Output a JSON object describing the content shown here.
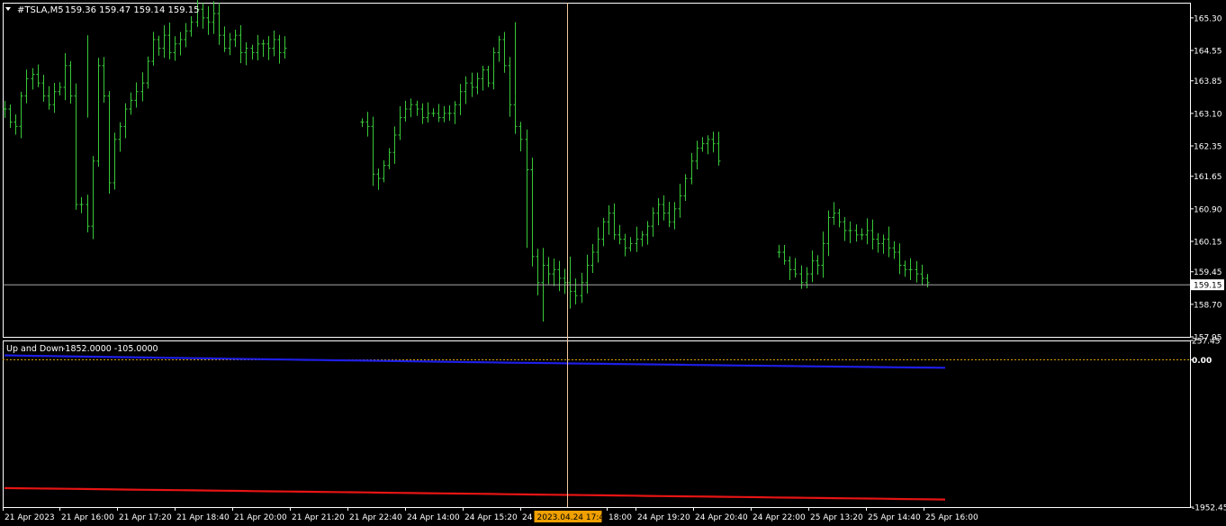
{
  "header": {
    "symbol": "#TSLA,M5",
    "ohlc": "159.36 159.47 159.14 159.15"
  },
  "colors": {
    "background": "#000000",
    "frame": "#ffffff",
    "bar": "#38c838",
    "crosshair": "#f5c8a0",
    "priceLine": "#c0c0c0",
    "zeroLine": "#d8a000",
    "series1": "#1e1ee6",
    "series2": "#e61414",
    "dateBadgeBg": "#f0a000",
    "dateBadgeText": "#000000"
  },
  "chart_data": [
    {
      "type": "ohlc",
      "symbol": "#TSLA",
      "timeframe": "M5",
      "ylim": [
        157.95,
        165.65
      ],
      "yticks": [
        "165.30",
        "164.55",
        "163.85",
        "163.10",
        "162.35",
        "161.65",
        "160.90",
        "160.15",
        "159.45",
        "158.70",
        "157.95"
      ],
      "current_price": "159.15",
      "segments": [
        {
          "start": 0,
          "close": [
            163.2,
            162.9,
            162.8,
            163.5,
            163.9,
            164.0,
            163.8,
            163.5,
            163.3,
            163.6,
            163.7,
            164.2,
            163.5,
            161.0,
            161.0,
            160.5,
            162.0,
            164.2,
            163.5,
            161.5,
            162.5,
            162.8,
            163.2,
            163.4,
            163.6,
            163.8,
            164.3,
            164.8,
            164.6,
            164.9,
            164.5,
            164.7,
            164.8,
            165.0,
            165.2,
            165.5,
            165.3,
            165.2,
            165.4,
            164.9,
            164.6,
            164.8,
            164.9,
            164.5,
            164.6,
            164.5,
            164.7,
            164.7,
            164.6,
            164.8,
            164.5,
            164.6
          ]
        },
        {
          "start": 65,
          "close": [
            162.9,
            162.8,
            161.7,
            161.6,
            161.9,
            162.2,
            162.6,
            163.0,
            163.2,
            163.3,
            163.2,
            163.0,
            163.1,
            163.1,
            163.0,
            163.1,
            163.1,
            163.3,
            163.6,
            163.8,
            163.7,
            163.9,
            164.1,
            163.8,
            164.5,
            164.8,
            164.2,
            163.3,
            162.8,
            162.5,
            161.8,
            159.8,
            159.2,
            159.6,
            159.4,
            159.5,
            159.3,
            159.2,
            159.0,
            158.9,
            159.2,
            159.6,
            159.9,
            160.2,
            160.6,
            160.8,
            160.3,
            160.2,
            160.0,
            160.1,
            160.2,
            160.3,
            160.5,
            160.8,
            161.0,
            160.8,
            160.6,
            160.9,
            161.2,
            161.6,
            162.0,
            162.3,
            162.4,
            162.5,
            162.4,
            162.0
          ]
        },
        {
          "start": 141,
          "close": [
            159.9,
            159.7,
            159.5,
            159.4,
            159.2,
            159.4,
            159.7,
            159.6,
            160.1,
            160.7,
            160.8,
            160.6,
            160.4,
            160.4,
            160.3,
            160.3,
            160.4,
            160.2,
            160.1,
            160.2,
            160.0,
            159.9,
            159.6,
            159.5,
            159.5,
            159.4,
            159.3,
            159.2
          ]
        }
      ]
    },
    {
      "type": "line",
      "title": "Up and Down",
      "values_label": "-1852.0000 -105.0000",
      "ylim": [
        -1952.45,
        257.45
      ],
      "yticks": [
        "257.45",
        "0.00",
        "-1952.45"
      ],
      "zero_line": 0,
      "series": [
        {
          "values": [
            60,
            -105
          ]
        },
        {
          "values": [
            -1700,
            -1852
          ]
        }
      ]
    }
  ],
  "x_axis": {
    "labels": [
      "21 Apr 2023",
      "21 Apr 16:00",
      "21 Apr 17:20",
      "21 Apr 18:40",
      "21 Apr 20:00",
      "21 Apr 21:20",
      "21 Apr 22:40",
      "24 Apr 14:00",
      "24 Apr 15:20",
      "24",
      "18:00",
      "24 Apr 19:20",
      "24 Apr 20:40",
      "24 Apr 22:00",
      "25 Apr 13:20",
      "25 Apr 14:40",
      "25 Apr 16:00"
    ],
    "crosshair_date": "2023.04.24 17:45"
  }
}
